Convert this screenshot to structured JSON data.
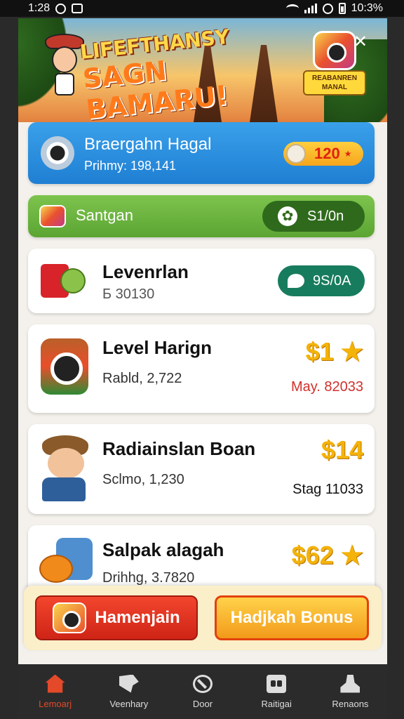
{
  "status_bar": {
    "time": "1:28",
    "battery_text": "10:3%"
  },
  "banner": {
    "title_line1": "LIFEFTHANSY",
    "title_line2": "SAGN BAMARU!",
    "badge_text": "REABANREN MANAL"
  },
  "featured": {
    "title": "Braergahn Hagal",
    "subtitle": "Prihmy: 198,141",
    "coins": "120"
  },
  "section": {
    "title": "Santgan",
    "price": "S1/0n"
  },
  "items": [
    {
      "title": "Levenrlan",
      "subtitle": "Б 30130",
      "price": "9S/0A"
    },
    {
      "title": "Level Harign",
      "subtitle": "Rabld, 2,722",
      "price": "$1",
      "meta": "May. 82033"
    },
    {
      "title": "Radiainslan Boan",
      "subtitle": "Sclmo, 1,230",
      "price": "$14",
      "meta": "Stag 11033"
    },
    {
      "title": "Salpak alagah",
      "subtitle": "Drihhg, 3.7820",
      "price": "$62"
    }
  ],
  "actions": {
    "primary": "Hamenjain",
    "secondary": "Hadjkah Bonus"
  },
  "nav": [
    {
      "label": "Lemoarj",
      "icon": "home-icon"
    },
    {
      "label": "Veenhary",
      "icon": "flag-icon"
    },
    {
      "label": "Door",
      "icon": "compass-icon"
    },
    {
      "label": "Raitigai",
      "icon": "gift-box-icon"
    },
    {
      "label": "Renaons",
      "icon": "user-icon"
    }
  ],
  "colors": {
    "accent_blue": "#2a8fe0",
    "accent_green": "#6cb53f",
    "accent_red": "#e44a2a",
    "price_gold": "#f4b30a"
  }
}
